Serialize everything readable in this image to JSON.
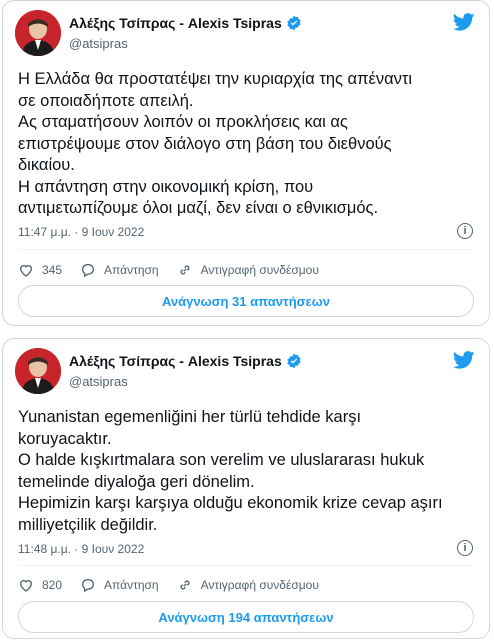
{
  "tweets": [
    {
      "author": "Αλέξης Τσίπρας - Alexis Tsipras",
      "handle": "@atsipras",
      "lines": [
        "Η Ελλάδα θα προστατέψει την κυριαρχία της απέναντι",
        "σε οποιαδήποτε απειλή.",
        "Ας σταματήσουν λοιπόν οι προκλήσεις και ας",
        "επιστρέψουμε στον διάλογο στη βάση του διεθνούς",
        "δικαίου.",
        "Η απάντηση στην οικονομική κρίση, που",
        "αντιμετωπίζουμε όλοι μαζί, δεν είναι ο εθνικισμός."
      ],
      "timestamp": "11:47 μ.μ. · 9 Ιουν 2022",
      "likes": "345",
      "reply_label": "Απάντηση",
      "copy_link_label": "Αντιγραφή συνδέσμου",
      "read_replies": "Ανάγνωση 31 απαντήσεων"
    },
    {
      "author": "Αλέξης Τσίπρας - Alexis Tsipras",
      "handle": "@atsipras",
      "lines": [
        "Yunanistan egemenliğini her türlü tehdide karşı",
        "koruyacaktır.",
        "O halde kışkırtmalara son verelim ve uluslararası hukuk",
        "temelinde diyaloğa geri dönelim.",
        "Hepimizin karşı karşıya olduğu ekonomik krize cevap aşırı",
        "milliyetçilik değildir."
      ],
      "timestamp": "11:48 μ.μ. · 9 Ιουν 2022",
      "likes": "820",
      "reply_label": "Απάντηση",
      "copy_link_label": "Αντιγραφή συνδέσμου",
      "read_replies": "Ανάγνωση 194 απαντήσεων"
    }
  ],
  "colors": {
    "accent": "#1d9bf0",
    "like_red": "#c8242b",
    "muted": "#536471"
  },
  "icons": [
    "verified-badge-icon",
    "twitter-bird-icon",
    "info-icon",
    "heart-icon",
    "reply-icon",
    "link-icon"
  ]
}
